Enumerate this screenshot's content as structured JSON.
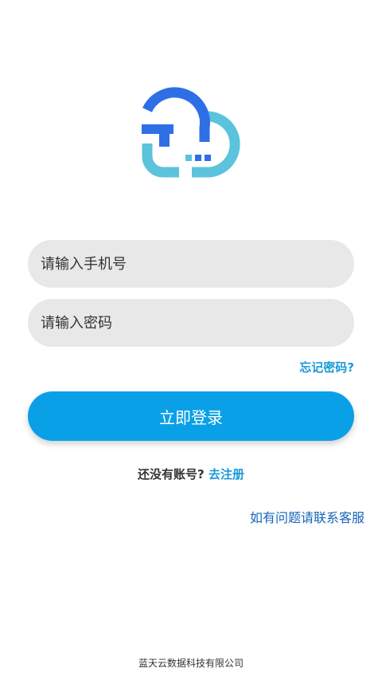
{
  "form": {
    "phone_placeholder": "请输入手机号",
    "password_placeholder": "请输入密码",
    "forgot_label": "忘记密码?",
    "login_label": "立即登录"
  },
  "register": {
    "prompt": "还没有账号?",
    "link_label": "去注册"
  },
  "support": {
    "contact_label": "如有问题请联系客服"
  },
  "footer": {
    "company": "蓝天云数据科技有限公司"
  },
  "colors": {
    "accent": "#0aa0e8",
    "link": "#1a9ad6",
    "logo_blue": "#2e6fe6",
    "logo_cyan": "#5bc3dc"
  },
  "icons": {
    "logo": "cloud-logo-icon"
  }
}
